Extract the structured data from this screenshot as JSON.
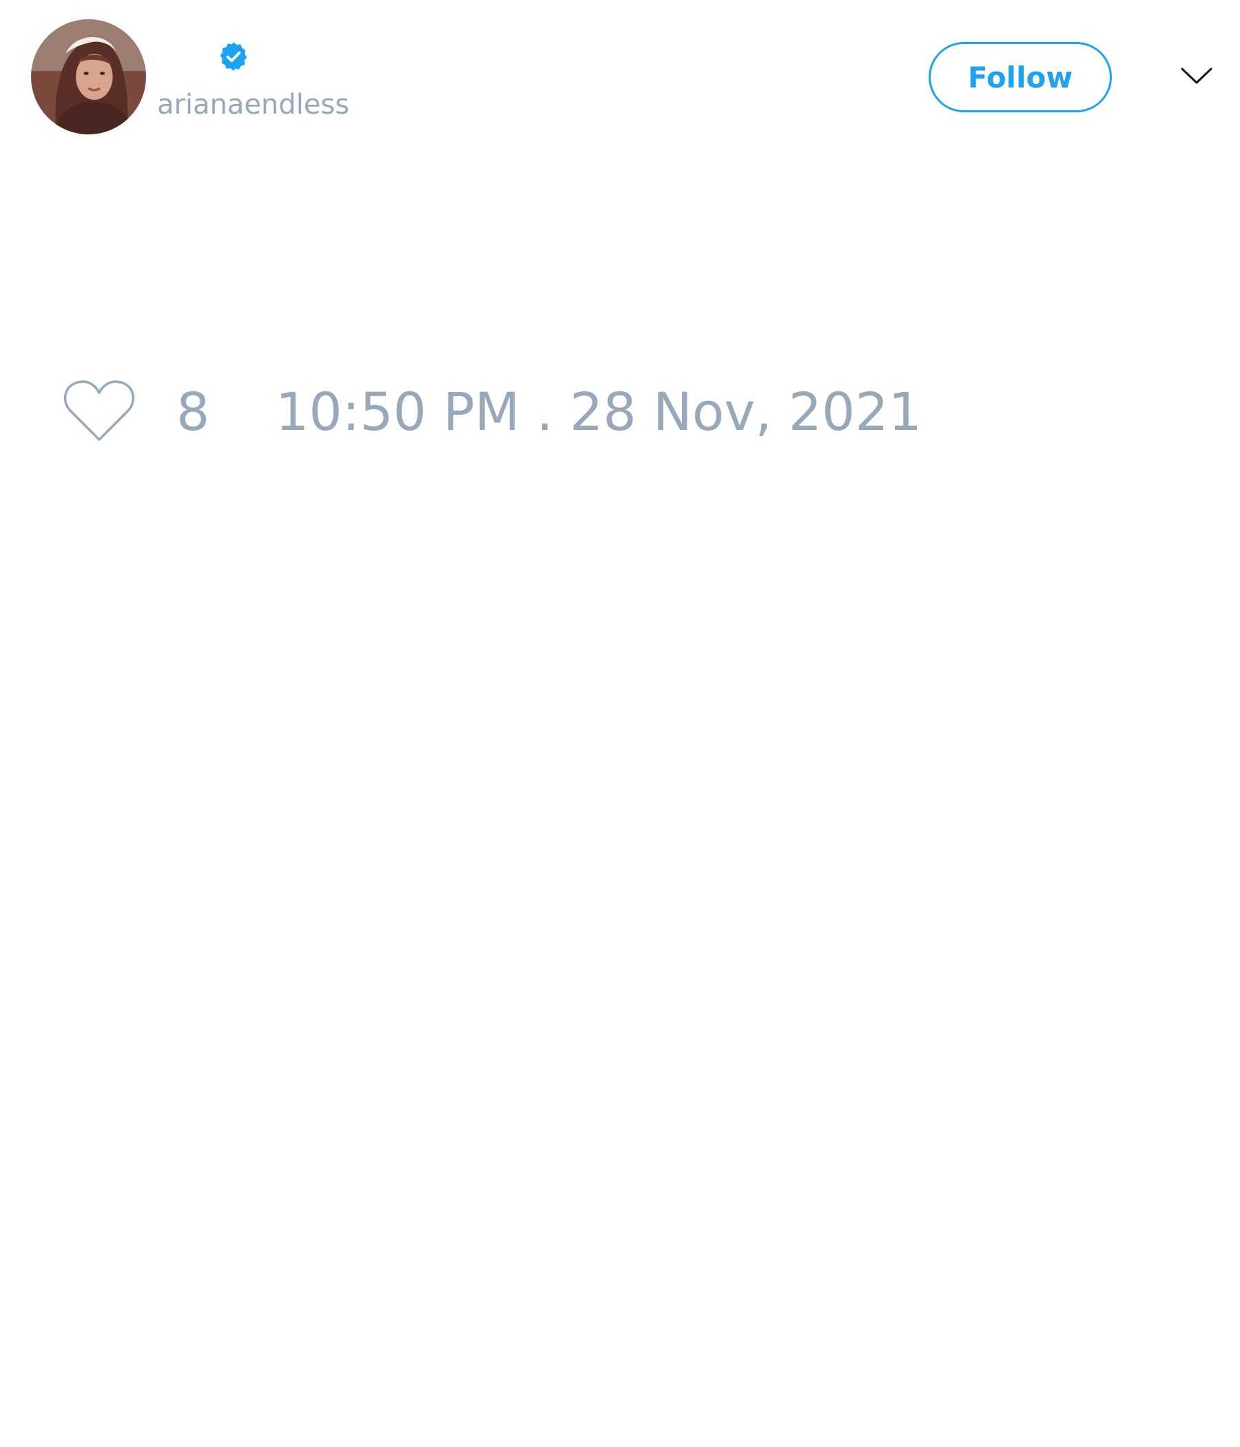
{
  "author": {
    "handle": "arianaendless",
    "avatar_icon": "profile-photo",
    "verified_icon": "verified-badge-icon"
  },
  "header": {
    "follow_label": "Follow",
    "menu_icon": "chevron-down-icon"
  },
  "footer": {
    "like_icon": "heart-icon",
    "like_count": "8",
    "timestamp": "10:50 PM . 28 Nov, 2021"
  },
  "colors": {
    "accent": "#1da1f2",
    "muted_text": "#98a8bb",
    "background": "#ffffff"
  }
}
